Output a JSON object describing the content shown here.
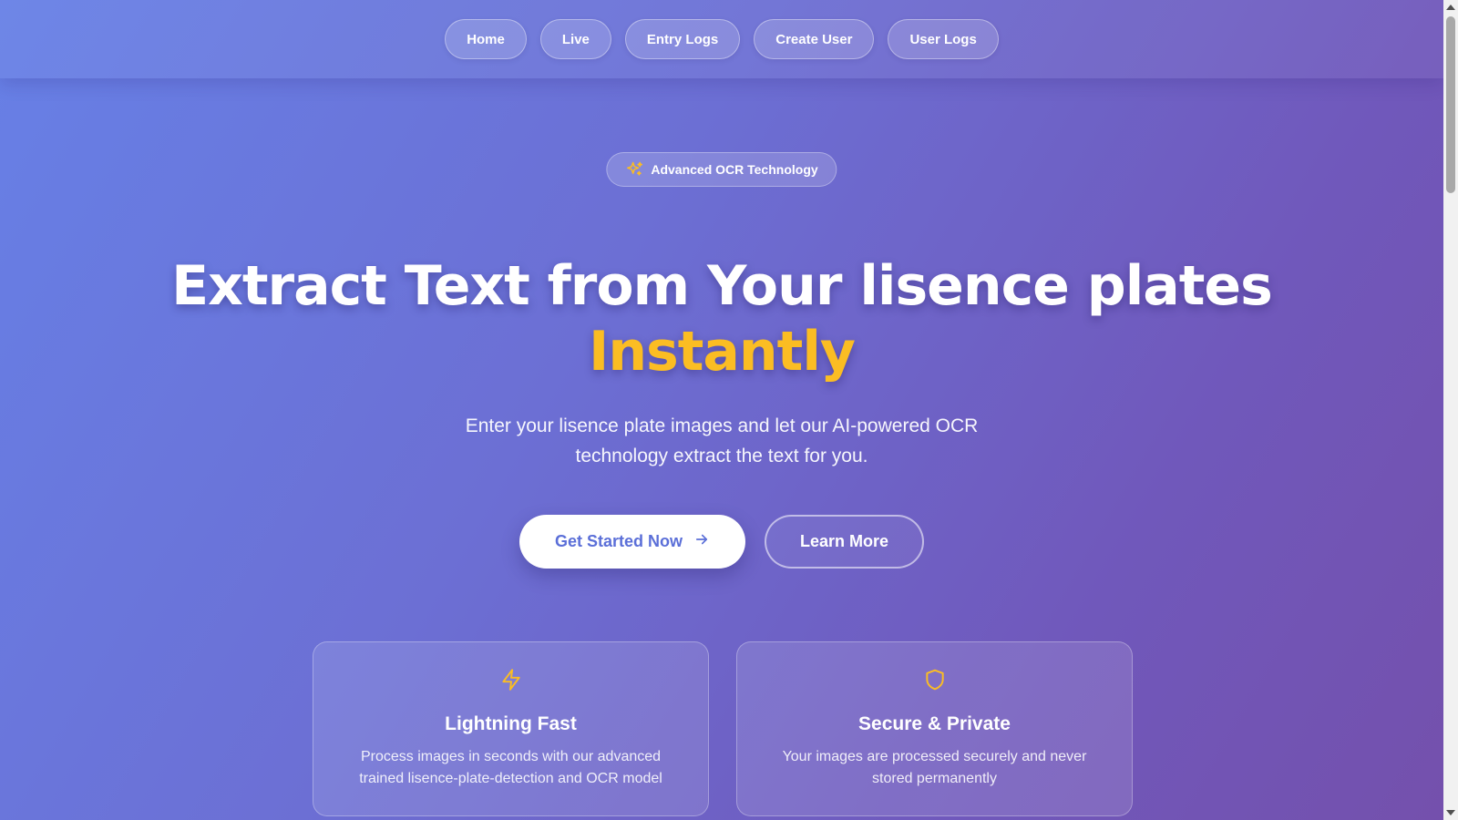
{
  "nav": {
    "items": [
      {
        "label": "Home"
      },
      {
        "label": "Live"
      },
      {
        "label": "Entry Logs"
      },
      {
        "label": "Create User"
      },
      {
        "label": "User Logs"
      }
    ]
  },
  "hero": {
    "badge": "Advanced OCR Technology",
    "title_line1": "Extract Text from Your lisence plates",
    "title_accent": "Instantly",
    "subtitle": "Enter your lisence plate images and let our AI-powered OCR technology extract the text for you.",
    "primary_cta": "Get Started Now",
    "secondary_cta": "Learn More"
  },
  "features": [
    {
      "icon": "lightning-icon",
      "title": "Lightning Fast",
      "description": "Process images in seconds with our advanced trained lisence-plate-detection and OCR model"
    },
    {
      "icon": "shield-icon",
      "title": "Secure & Private",
      "description": "Your images are processed securely and never stored permanently"
    }
  ],
  "colors": {
    "accent": "#fbbd23",
    "primary_button_text": "#5b6fd8",
    "gradient_start": "#6780e6",
    "gradient_end": "#7450ac"
  }
}
